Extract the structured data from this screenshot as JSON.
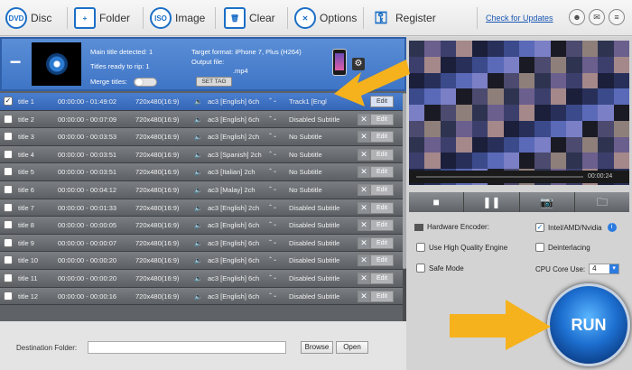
{
  "toolbar": {
    "disc": "Disc",
    "folder": "Folder",
    "image": "Image",
    "clear": "Clear",
    "options": "Options",
    "register": "Register",
    "check_updates": "Check for Updates"
  },
  "header": {
    "main_title": "Main title detected: 1",
    "ready": "Titles ready to rip: 1",
    "merge": "Merge titles:",
    "target": "Target format: iPhone 7, Plus (H264)",
    "output_file": "Output file:",
    "output_name": ".mp4",
    "set_tag": "SET TAG"
  },
  "titles": [
    {
      "name": "title 1",
      "time": "00:00:00 - 01:49:02",
      "res": "720x480(16:9)",
      "audio": "ac3 [English] 6ch",
      "sub": "Track1 [Engl",
      "checked": true,
      "selected": true
    },
    {
      "name": "title 2",
      "time": "00:00:00 - 00:07:09",
      "res": "720x480(16:9)",
      "audio": "ac3 [English] 6ch",
      "sub": "Disabled Subtitle",
      "checked": false,
      "selected": false
    },
    {
      "name": "title 3",
      "time": "00:00:00 - 00:03:53",
      "res": "720x480(16:9)",
      "audio": "ac3 [English] 2ch",
      "sub": "No Subtitle",
      "checked": false,
      "selected": false
    },
    {
      "name": "title 4",
      "time": "00:00:00 - 00:03:51",
      "res": "720x480(16:9)",
      "audio": "ac3 [Spanish] 2ch",
      "sub": "No Subtitle",
      "checked": false,
      "selected": false
    },
    {
      "name": "title 5",
      "time": "00:00:00 - 00:03:51",
      "res": "720x480(16:9)",
      "audio": "ac3 [Italian] 2ch",
      "sub": "No Subtitle",
      "checked": false,
      "selected": false
    },
    {
      "name": "title 6",
      "time": "00:00:00 - 00:04:12",
      "res": "720x480(16:9)",
      "audio": "ac3 [Malay] 2ch",
      "sub": "No Subtitle",
      "checked": false,
      "selected": false
    },
    {
      "name": "title 7",
      "time": "00:00:00 - 00:01:33",
      "res": "720x480(16:9)",
      "audio": "ac3 [English] 2ch",
      "sub": "Disabled Subtitle",
      "checked": false,
      "selected": false
    },
    {
      "name": "title 8",
      "time": "00:00:00 - 00:00:05",
      "res": "720x480(16:9)",
      "audio": "ac3 [English] 6ch",
      "sub": "Disabled Subtitle",
      "checked": false,
      "selected": false
    },
    {
      "name": "title 9",
      "time": "00:00:00 - 00:00:07",
      "res": "720x480(16:9)",
      "audio": "ac3 [English] 6ch",
      "sub": "Disabled Subtitle",
      "checked": false,
      "selected": false
    },
    {
      "name": "title 10",
      "time": "00:00:00 - 00:00:20",
      "res": "720x480(16:9)",
      "audio": "ac3 [English] 6ch",
      "sub": "Disabled Subtitle",
      "checked": false,
      "selected": false
    },
    {
      "name": "title 11",
      "time": "00:00:00 - 00:00:20",
      "res": "720x480(16:9)",
      "audio": "ac3 [English] 6ch",
      "sub": "Disabled Subtitle",
      "checked": false,
      "selected": false
    },
    {
      "name": "title 12",
      "time": "00:00:00 - 00:00:16",
      "res": "720x480(16:9)",
      "audio": "ac3 [English] 6ch",
      "sub": "Disabled Subtitle",
      "checked": false,
      "selected": false
    }
  ],
  "edit_label": "Edit",
  "player": {
    "time": "00:00:24"
  },
  "options": {
    "hw_encoder": "Hardware Encoder:",
    "intel": "Intel/AMD/Nvidia",
    "hq_engine": "Use High Quality Engine",
    "deinterlacing": "Deinterlacing",
    "safe_mode": "Safe Mode",
    "cpu_core": "CPU Core Use:",
    "cpu_value": "4"
  },
  "destination": {
    "label": "Destination Folder:",
    "value": "",
    "browse": "Browse",
    "open": "Open"
  },
  "run_label": "RUN",
  "colors": {
    "accent": "#1c6fc6",
    "arrow": "#f5b21c",
    "selected_row": "#3f75c6"
  }
}
